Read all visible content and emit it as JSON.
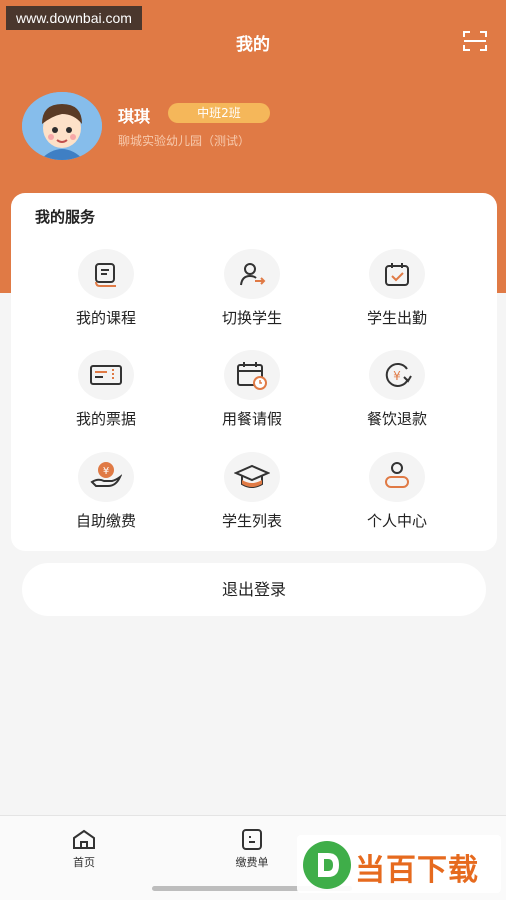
{
  "watermark_top": "www.downbai.com",
  "header": {
    "title": "我的"
  },
  "profile": {
    "name": "琪琪",
    "class": "中班2班",
    "school": "聊城实验幼儿园（测试）"
  },
  "services": {
    "title": "我的服务",
    "items": [
      {
        "label": "我的课程",
        "icon": "book-icon"
      },
      {
        "label": "切换学生",
        "icon": "switch-student-icon"
      },
      {
        "label": "学生出勤",
        "icon": "calendar-check-icon"
      },
      {
        "label": "我的票据",
        "icon": "ticket-icon"
      },
      {
        "label": "用餐请假",
        "icon": "calendar-clock-icon"
      },
      {
        "label": "餐饮退款",
        "icon": "refund-icon"
      },
      {
        "label": "自助缴费",
        "icon": "hand-coin-icon"
      },
      {
        "label": "学生列表",
        "icon": "graduation-cap-icon"
      },
      {
        "label": "个人中心",
        "icon": "person-icon"
      }
    ]
  },
  "logout_label": "退出登录",
  "tabbar": {
    "items": [
      {
        "label": "首页",
        "icon": "home-icon"
      },
      {
        "label": "缴费单",
        "icon": "bill-icon"
      }
    ]
  },
  "brand_watermark": "当百下载",
  "colors": {
    "accent": "#e07a45",
    "badge": "#f5b75a",
    "background": "#f5f5f5"
  }
}
